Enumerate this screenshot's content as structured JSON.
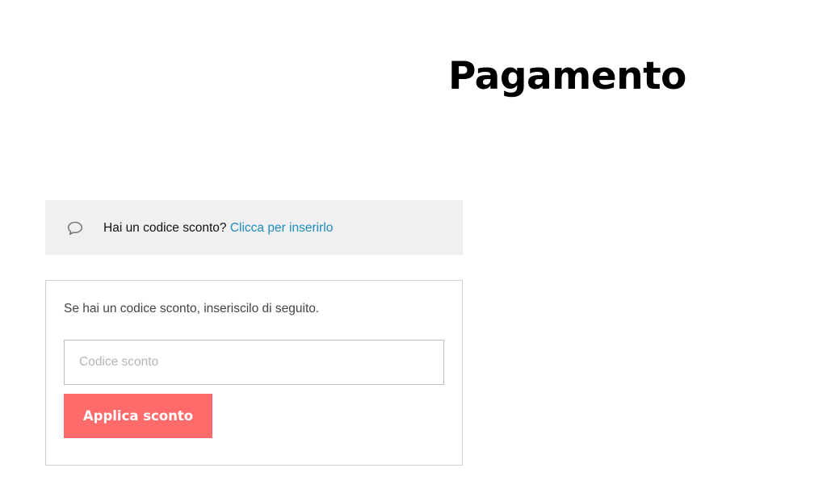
{
  "page": {
    "title": "Pagamento"
  },
  "coupon_notice": {
    "icon": "speech-bubble-icon",
    "text": "Hai un codice sconto?",
    "link_label": "Clicca per inserirlo"
  },
  "coupon_form": {
    "description": "Se hai un codice sconto, inseriscilo di seguito.",
    "input_value": "",
    "input_placeholder": "Codice sconto",
    "apply_label": "Applica sconto"
  },
  "colors": {
    "accent_button": "#ff6b6b",
    "link": "#1e8cbe",
    "notice_background": "#f0f0f0"
  }
}
